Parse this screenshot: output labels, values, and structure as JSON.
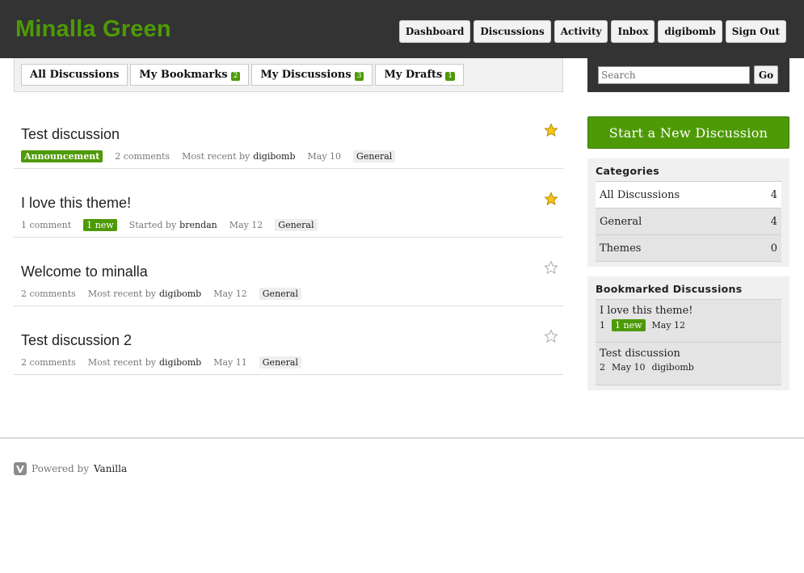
{
  "site": {
    "title": "Minalla Green"
  },
  "nav": [
    {
      "label": "Dashboard"
    },
    {
      "label": "Discussions"
    },
    {
      "label": "Activity"
    },
    {
      "label": "Inbox"
    },
    {
      "label": "digibomb"
    },
    {
      "label": "Sign Out"
    }
  ],
  "tabs": [
    {
      "label": "All Discussions",
      "count": ""
    },
    {
      "label": "My Bookmarks",
      "count": "2"
    },
    {
      "label": "My Discussions",
      "count": "3"
    },
    {
      "label": "My Drafts",
      "count": "1"
    }
  ],
  "discussions": [
    {
      "title": "Test discussion",
      "announcement": "Announcement",
      "comments": "2 comments",
      "new": "",
      "by_label": "Most recent by",
      "user": "digibomb",
      "date": "May 10",
      "category": "General",
      "bookmarked": true
    },
    {
      "title": "I love this theme!",
      "announcement": "",
      "comments": "1 comment",
      "new": "1 new",
      "by_label": "Started by",
      "user": "brendan",
      "date": "May 12",
      "category": "General",
      "bookmarked": true
    },
    {
      "title": "Welcome to minalla",
      "announcement": "",
      "comments": "2 comments",
      "new": "",
      "by_label": "Most recent by",
      "user": "digibomb",
      "date": "May 12",
      "category": "General",
      "bookmarked": false
    },
    {
      "title": "Test discussion 2",
      "announcement": "",
      "comments": "2 comments",
      "new": "",
      "by_label": "Most recent by",
      "user": "digibomb",
      "date": "May 11",
      "category": "General",
      "bookmarked": false
    }
  ],
  "search": {
    "placeholder": "Search",
    "value": "",
    "button": "Go"
  },
  "new_discussion": "Start a New Discussion",
  "categories": {
    "title": "Categories",
    "items": [
      {
        "name": "All Discussions",
        "count": "4",
        "active": true
      },
      {
        "name": "General",
        "count": "4",
        "active": false
      },
      {
        "name": "Themes",
        "count": "0",
        "active": false
      }
    ]
  },
  "bookmarks": {
    "title": "Bookmarked Discussions",
    "items": [
      {
        "title": "I love this theme!",
        "count": "1",
        "new": "1 new",
        "date": "May 12",
        "user": ""
      },
      {
        "title": "Test discussion",
        "count": "2",
        "new": "",
        "date": "May 10",
        "user": "digibomb"
      }
    ]
  },
  "footer": {
    "powered_by": "Powered by",
    "link": "Vanilla"
  },
  "colors": {
    "accent": "#4e9a06",
    "header_bg": "#333333",
    "star_on": "#f5c518"
  },
  "icons": {
    "bookmark": "star-icon",
    "footer_logo": "vanilla-logo-icon"
  }
}
